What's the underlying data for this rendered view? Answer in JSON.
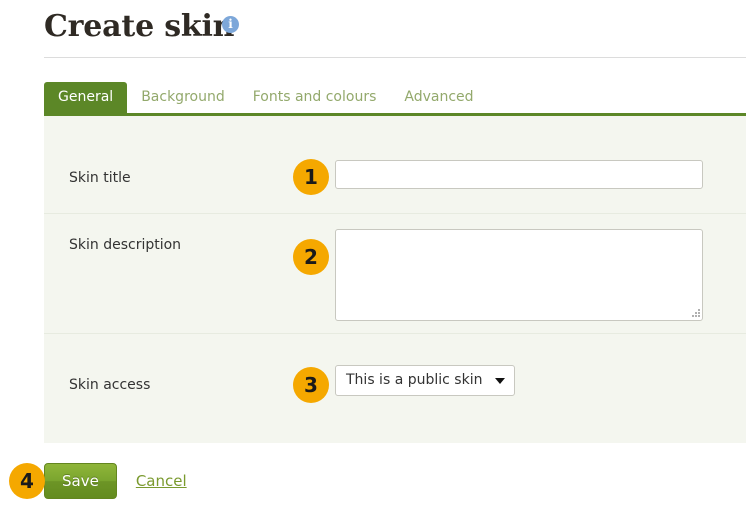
{
  "header": {
    "title": "Create skin",
    "info_icon": "info-icon",
    "info_icon_glyph": "i"
  },
  "tabs": [
    {
      "label": "General",
      "active": true
    },
    {
      "label": "Background",
      "active": false
    },
    {
      "label": "Fonts and colours",
      "active": false
    },
    {
      "label": "Advanced",
      "active": false
    }
  ],
  "form": {
    "fields": [
      {
        "label": "Skin title",
        "type": "text",
        "value": "",
        "placeholder": "",
        "step": "1"
      },
      {
        "label": "Skin description",
        "type": "textarea",
        "value": "",
        "placeholder": "",
        "step": "2"
      },
      {
        "label": "Skin access",
        "type": "select",
        "value": "This is a public skin",
        "options": [
          "This is a public skin"
        ],
        "caret_icon": "chevron-down-icon",
        "step": "3"
      }
    ]
  },
  "actions": {
    "save_label": "Save",
    "cancel_label": "Cancel",
    "step": "4"
  },
  "colors": {
    "accent_green": "#5c8727",
    "badge_orange": "#f5a800",
    "panel_bg": "#f4f6ef",
    "tab_inactive_text": "#93a96c",
    "info_blue": "#7da7d9",
    "link_green": "#7a9a2e"
  }
}
